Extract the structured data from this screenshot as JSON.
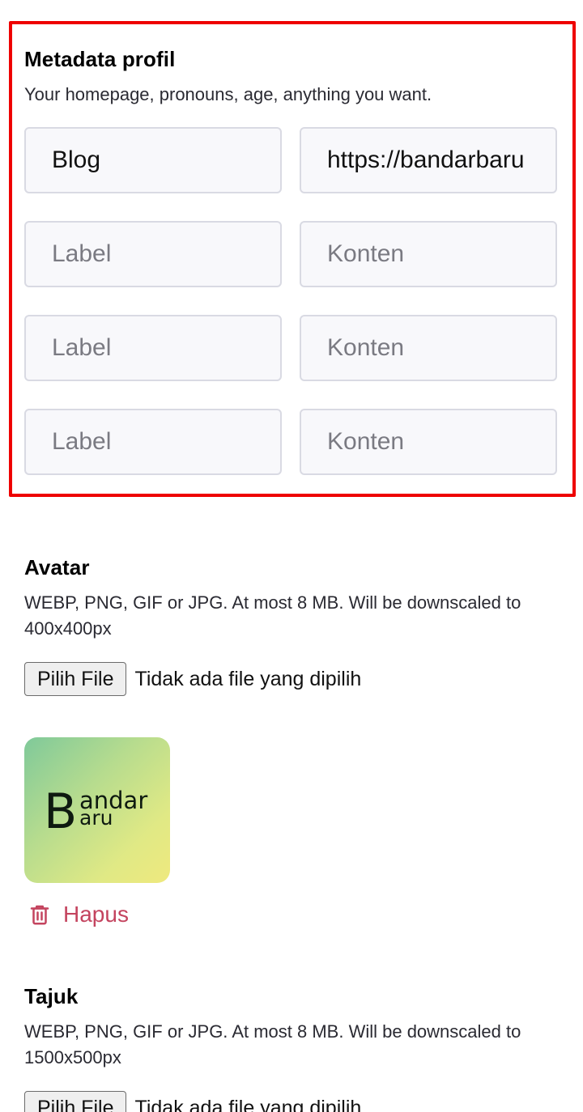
{
  "metadata": {
    "title": "Metadata profil",
    "hint": "Your homepage, pronouns, age, anything you want.",
    "rows": [
      {
        "label_value": "Blog",
        "content_value": "https://bandarbaru",
        "label_placeholder": "Label",
        "content_placeholder": "Konten"
      },
      {
        "label_value": "",
        "content_value": "",
        "label_placeholder": "Label",
        "content_placeholder": "Konten"
      },
      {
        "label_value": "",
        "content_value": "",
        "label_placeholder": "Label",
        "content_placeholder": "Konten"
      },
      {
        "label_value": "",
        "content_value": "",
        "label_placeholder": "Label",
        "content_placeholder": "Konten"
      }
    ]
  },
  "avatar": {
    "title": "Avatar",
    "hint": "WEBP, PNG, GIF or JPG. At most 8 MB. Will be downscaled to 400x400px",
    "choose_button": "Pilih File",
    "file_status": "Tidak ada file yang dipilih",
    "logo_letter": "B",
    "logo_line1": "andar",
    "logo_line2": "aru",
    "remove_label": "Hapus",
    "remove_icon": "trash-icon"
  },
  "header_image": {
    "title": "Tajuk",
    "hint": "WEBP, PNG, GIF or JPG. At most 8 MB. Will be downscaled to 1500x500px",
    "choose_button": "Pilih File",
    "file_status": "Tidak ada file yang dipilih"
  },
  "colors": {
    "highlight": "#ee0000",
    "danger": "#c4445f",
    "field_bg": "#f8f8fb",
    "field_border": "#d9dae3"
  }
}
